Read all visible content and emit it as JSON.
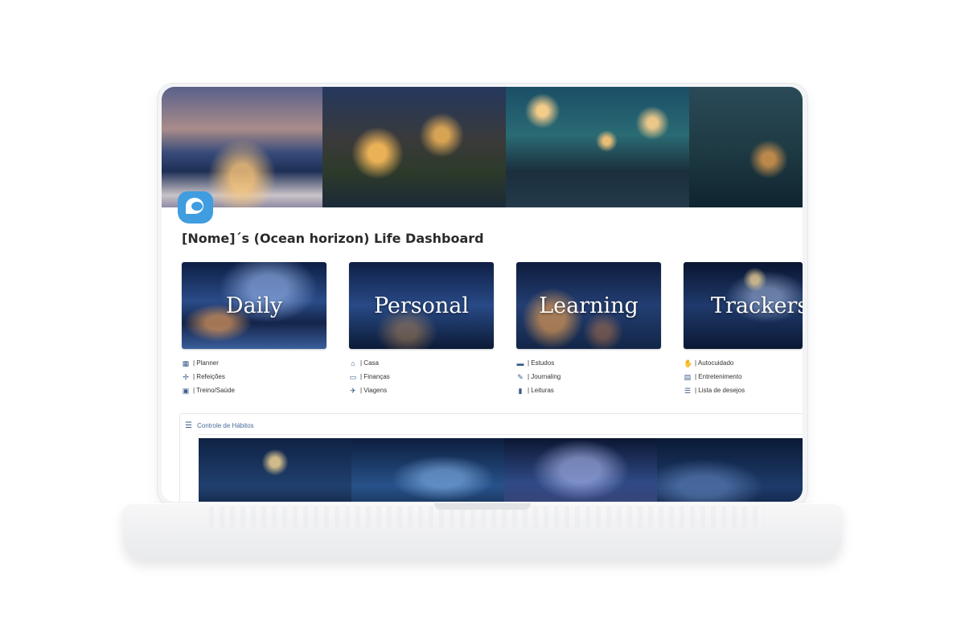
{
  "page": {
    "title": "[Nome]´s (Ocean horizon) Life Dashboard",
    "icon": "ocean-wave-icon",
    "cover": [
      "lakeside-village-dusk",
      "japanese-house-bridge-night",
      "rainy-street-lamps",
      "lake-night-lanterns"
    ]
  },
  "cards": [
    {
      "label": "Daily",
      "links": [
        {
          "icon": "calendar-icon",
          "text": "| Planner"
        },
        {
          "icon": "utensils-icon",
          "text": "| Refeições"
        },
        {
          "icon": "heart-pulse-icon",
          "text": "| Treino/Saúde"
        }
      ]
    },
    {
      "label": "Personal",
      "links": [
        {
          "icon": "home-icon",
          "text": "| Casa"
        },
        {
          "icon": "wallet-icon",
          "text": "| Finanças"
        },
        {
          "icon": "airplane-icon",
          "text": "| Viagens"
        }
      ]
    },
    {
      "label": "Learning",
      "links": [
        {
          "icon": "monitor-icon",
          "text": "| Estudos"
        },
        {
          "icon": "pen-icon",
          "text": "| Journaling"
        },
        {
          "icon": "book-icon",
          "text": "| Leituras"
        }
      ]
    },
    {
      "label": "Trackers",
      "links": [
        {
          "icon": "self-care-icon",
          "text": "| Autocuidado"
        },
        {
          "icon": "film-icon",
          "text": "| Entretenimento"
        },
        {
          "icon": "checklist-icon",
          "text": "| Lista de desejos"
        }
      ]
    }
  ],
  "habits": {
    "title": "Controle de Hábitos",
    "icon": "checklist-icon"
  },
  "colors": {
    "link_icon": "#3b5c8a",
    "page_icon": "#3f9de0",
    "habit_title": "#4a6a98"
  }
}
